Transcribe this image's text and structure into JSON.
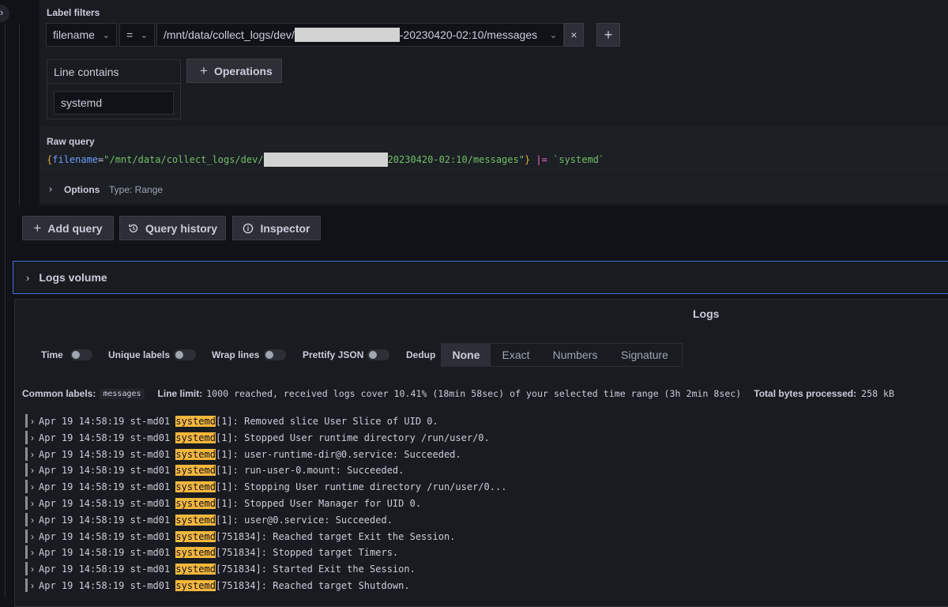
{
  "edge_toggle_glyph": "›",
  "label_filters": {
    "title": "Label filters",
    "label": "filename",
    "operator": "=",
    "value_prefix": "/mnt/data/collect_logs/dev/",
    "value_suffix": "-20230420-02:10/messages",
    "remove_glyph": "×",
    "add_glyph": "+"
  },
  "line_contains": {
    "title": "Line contains",
    "value": "systemd"
  },
  "operations_button": {
    "icon": "+",
    "label": "Operations"
  },
  "raw_query": {
    "title": "Raw query",
    "brace_open": "{",
    "key": "filename",
    "eq": "=",
    "value_prefix": "\"/mnt/data/collect_logs/dev/",
    "value_suffix": "20230420-02:10/messages\"",
    "brace_close": "}",
    "pipe_op": " |= ",
    "filter": "`systemd`"
  },
  "options": {
    "chevron": "›",
    "label": "Options",
    "type_text": "Type: Range"
  },
  "buttons": {
    "add_query": {
      "icon": "+",
      "label": "Add query"
    },
    "query_history": {
      "icon": "history-icon",
      "label": "Query history"
    },
    "inspector": {
      "icon": "info-icon",
      "label": "Inspector"
    }
  },
  "logs_volume": {
    "chevron": "›",
    "label": "Logs volume"
  },
  "logs_panel": {
    "title": "Logs",
    "toggles": [
      "Time",
      "Unique labels",
      "Wrap lines",
      "Prettify JSON"
    ],
    "dedup_label": "Dedup",
    "dedup_options": [
      "None",
      "Exact",
      "Numbers",
      "Signature"
    ],
    "dedup_selected": "None",
    "common_labels_label": "Common labels:",
    "common_labels_value": "messages",
    "line_limit_label": "Line limit:",
    "line_limit_text": "1000 reached, received logs cover 10.41% (18min 58sec) of your selected time range (3h 2min 8sec)",
    "bytes_label": "Total bytes processed:",
    "bytes_value": "258 kB"
  },
  "log_lines": [
    {
      "prefix": "Apr 19 14:58:19 st-md01 ",
      "keyword": "systemd",
      "rest": "[1]: Removed slice User Slice of UID 0."
    },
    {
      "prefix": "Apr 19 14:58:19 st-md01 ",
      "keyword": "systemd",
      "rest": "[1]: Stopped User runtime directory /run/user/0."
    },
    {
      "prefix": "Apr 19 14:58:19 st-md01 ",
      "keyword": "systemd",
      "rest": "[1]: user-runtime-dir@0.service: Succeeded."
    },
    {
      "prefix": "Apr 19 14:58:19 st-md01 ",
      "keyword": "systemd",
      "rest": "[1]: run-user-0.mount: Succeeded."
    },
    {
      "prefix": "Apr 19 14:58:19 st-md01 ",
      "keyword": "systemd",
      "rest": "[1]: Stopping User runtime directory /run/user/0..."
    },
    {
      "prefix": "Apr 19 14:58:19 st-md01 ",
      "keyword": "systemd",
      "rest": "[1]: Stopped User Manager for UID 0."
    },
    {
      "prefix": "Apr 19 14:58:19 st-md01 ",
      "keyword": "systemd",
      "rest": "[1]: user@0.service: Succeeded."
    },
    {
      "prefix": "Apr 19 14:58:19 st-md01 ",
      "keyword": "systemd",
      "rest": "[751834]: Reached target Exit the Session."
    },
    {
      "prefix": "Apr 19 14:58:19 st-md01 ",
      "keyword": "systemd",
      "rest": "[751834]: Stopped target Timers."
    },
    {
      "prefix": "Apr 19 14:58:19 st-md01 ",
      "keyword": "systemd",
      "rest": "[751834]: Started Exit the Session."
    },
    {
      "prefix": "Apr 19 14:58:19 st-md01 ",
      "keyword": "systemd",
      "rest": "[751834]: Reached target Shutdown."
    }
  ],
  "colors": {
    "background": "#111217",
    "panel": "#181b1f",
    "accent_blue": "#3d71d9",
    "highlight": "#f5b73b",
    "query_brace": "#e5a823",
    "query_key": "#6e9fff",
    "query_value": "#73bf69",
    "query_op": "#ff66cc"
  }
}
